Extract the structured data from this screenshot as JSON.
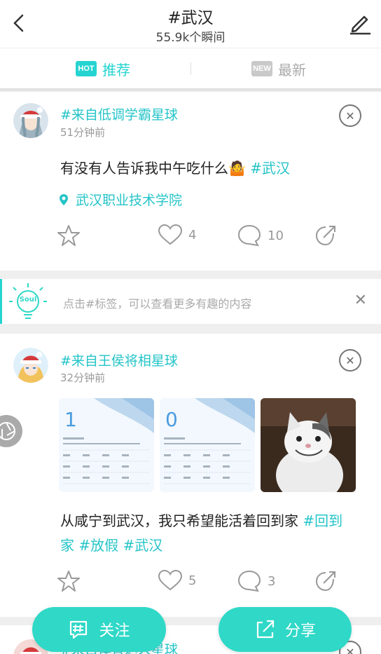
{
  "header": {
    "title": "#武汉",
    "subtitle": "55.9k个瞬间"
  },
  "tabs": [
    {
      "badge": "HOT",
      "label": "推荐"
    },
    {
      "badge": "NEW",
      "label": "最新"
    }
  ],
  "posts": [
    {
      "planet": "#来自低调学霸星球",
      "time": "51分钟前",
      "text": "有没有人告诉我中午吃什么🤷",
      "tags": [
        "#武汉"
      ],
      "location": "武汉职业技术学院",
      "likes": "4",
      "comments": "10"
    },
    {
      "planet": "#来自王侯将相星球",
      "time": "32分钟前",
      "text_line1": "从咸宁到武汉，我只希望能活着回到家 ",
      "tag_inline": "#回到",
      "tag_line2a": "家",
      "tag_line2b": "#放假",
      "tag_line2c": "#武汉",
      "weather1_temp": "1",
      "weather2_temp": "0",
      "likes": "5",
      "comments": "3"
    },
    {
      "planet": "#来自体育达人星球"
    }
  ],
  "tip": {
    "logo": "Soul",
    "text": "点击#标签，可以查看更多有趣的内容"
  },
  "buttons": {
    "follow": "关注",
    "share": "分享"
  },
  "colors": {
    "accent": "#25d4d0",
    "muted": "#999999"
  }
}
